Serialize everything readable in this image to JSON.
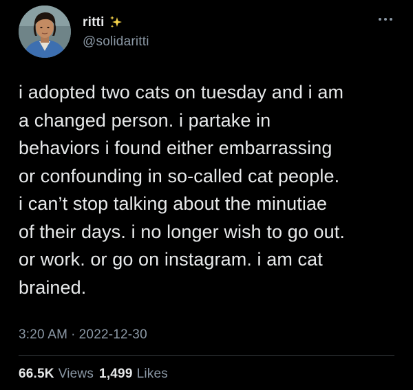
{
  "user": {
    "display_name": "ritti",
    "handle": "@solidaritti",
    "name_emoji": "sparkles-icon"
  },
  "tweet": {
    "text_lines": [
      "i adopted two cats on tuesday and i am",
      "a changed person. i partake in",
      "behaviors i found either embarrassing",
      "or confounding in so-called cat people.",
      "i can’t stop talking about the minutiae",
      "of their days. i no longer wish to go out.",
      "or work. or go on instagram. i am cat",
      "brained."
    ],
    "time": "3:20 AM",
    "separator": "·",
    "date": "2022-12-30"
  },
  "stats": {
    "views_count": "66.5K",
    "views_label": "Views",
    "likes_count": "1,499",
    "likes_label": "Likes"
  },
  "colors": {
    "background": "#000000",
    "primary_text": "#e7e9ea",
    "secondary_text": "#8b98a5",
    "sparkle": "#f7d44a"
  }
}
